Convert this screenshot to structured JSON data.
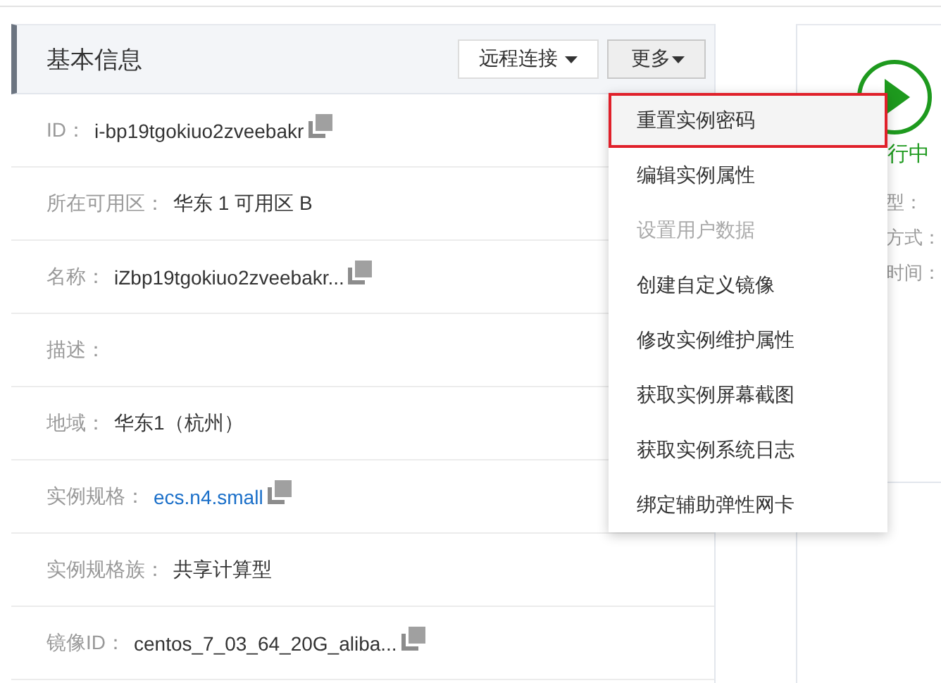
{
  "panel": {
    "title": "基本信息",
    "buttons": [
      {
        "label": "远程连接",
        "kind": "plain"
      },
      {
        "label": "更多",
        "kind": "open"
      }
    ],
    "fields": [
      {
        "label": "ID：",
        "value": "i-bp19tgokiuo2zveebakr",
        "kind": "text",
        "copy": true
      },
      {
        "label": "所在可用区：",
        "value": "华东 1 可用区 B",
        "kind": "text",
        "copy": false
      },
      {
        "label": "名称：",
        "value": "iZbp19tgokiuo2zveebakr...",
        "kind": "text",
        "copy": true
      },
      {
        "label": "描述：",
        "kind": "text",
        "copy": false
      },
      {
        "label": "地域：",
        "value": "华东1（杭州）",
        "kind": "text",
        "copy": false
      },
      {
        "label": "实例规格：",
        "value": "ecs.n4.small",
        "kind": "link",
        "copy": true
      },
      {
        "label": "实例规格族：",
        "value": "共享计算型",
        "kind": "text",
        "copy": false
      },
      {
        "label": "镜像ID：",
        "value": "centos_7_03_64_20G_aliba...",
        "kind": "text",
        "copy": true
      }
    ]
  },
  "status": {
    "state": "行中",
    "lines": [
      "型：",
      "方式：",
      "时间："
    ]
  },
  "menu": {
    "items": [
      {
        "label": "重置实例密码",
        "selected": true,
        "disabled": false
      },
      {
        "label": "编辑实例属性",
        "selected": false,
        "disabled": false
      },
      {
        "label": "设置用户数据",
        "selected": false,
        "disabled": true
      },
      {
        "label": "创建自定义镜像",
        "selected": false,
        "disabled": false
      },
      {
        "label": "修改实例维护属性",
        "selected": false,
        "disabled": false
      },
      {
        "label": "获取实例屏幕截图",
        "selected": false,
        "disabled": false
      },
      {
        "label": "获取实例系统日志",
        "selected": false,
        "disabled": false
      },
      {
        "label": "绑定辅助弹性网卡",
        "selected": false,
        "disabled": false
      }
    ]
  }
}
